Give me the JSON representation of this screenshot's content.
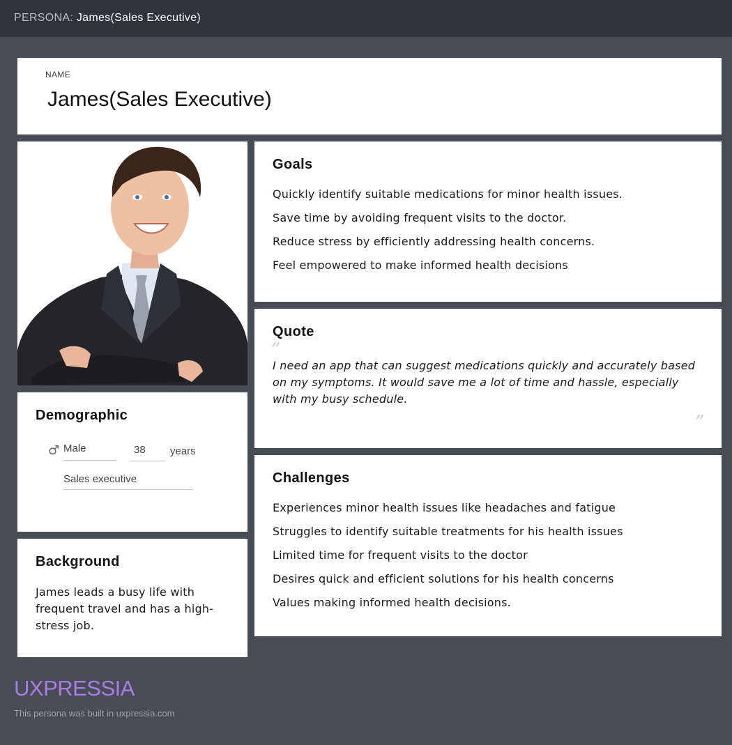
{
  "header": {
    "prefix": "PERSONA:",
    "name": "James(Sales Executive)"
  },
  "name_card": {
    "caption": "NAME",
    "name": "James(Sales Executive)"
  },
  "goals": {
    "title": "Goals",
    "items": [
      "Quickly identify suitable medications for minor health issues.",
      "Save time by avoiding frequent visits to the doctor.",
      "Reduce stress by efficiently addressing health concerns.",
      "Feel empowered to make informed health decisions"
    ]
  },
  "quote": {
    "title": "Quote",
    "open_mark": "“",
    "text": "I need an app that can suggest medications quickly and accurately based on my symptoms. It would save me a lot of time and hassle, especially with my busy schedule.",
    "close_mark": "”"
  },
  "demographic": {
    "title": "Demographic",
    "gender_icon": "male-icon",
    "gender": "Male",
    "age": "38",
    "age_unit": "years",
    "occupation": "Sales executive"
  },
  "background": {
    "title": "Background",
    "text": "James leads a busy life with frequent travel and has a high-stress job."
  },
  "challenges": {
    "title": "Challenges",
    "items": [
      "Experiences minor health issues like headaches and fatigue",
      "Struggles to identify suitable treatments for his health issues",
      "Limited time for frequent visits to the doctor",
      "Desires quick and efficient solutions for his health concerns",
      "Values making informed health decisions."
    ]
  },
  "footer": {
    "brand": "UXPRESSIA",
    "note": "This persona was built in uxpressia.com"
  },
  "colors": {
    "background": "#484c55",
    "topbar": "#2f333b",
    "brand": "#a97ce8"
  }
}
